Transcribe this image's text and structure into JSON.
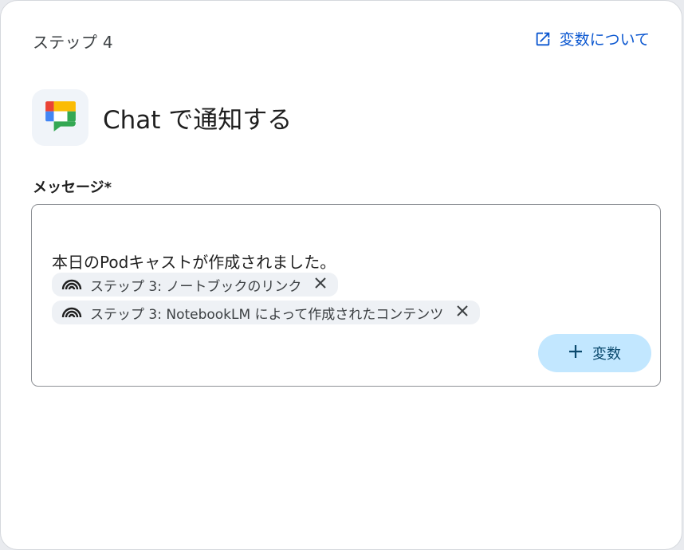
{
  "header": {
    "step_label": "ステップ 4",
    "vars_link_label": "変数について"
  },
  "action": {
    "title": "Chat で通知する",
    "icon": "google-chat-icon"
  },
  "field": {
    "label": "メッセージ*",
    "message_text": "本日のPodキャストが作成されました。",
    "chips": [
      {
        "label": "ステップ 3: ノートブックのリンク",
        "icon": "notebooklm-icon"
      },
      {
        "label": "ステップ 3: NotebookLM によって作成されたコンテンツ",
        "icon": "notebooklm-icon"
      }
    ],
    "add_variable_label": "変数"
  },
  "colors": {
    "link": "#0b57d0",
    "add_button_bg": "#c2e7ff",
    "chip_bg": "#eef1f5"
  }
}
